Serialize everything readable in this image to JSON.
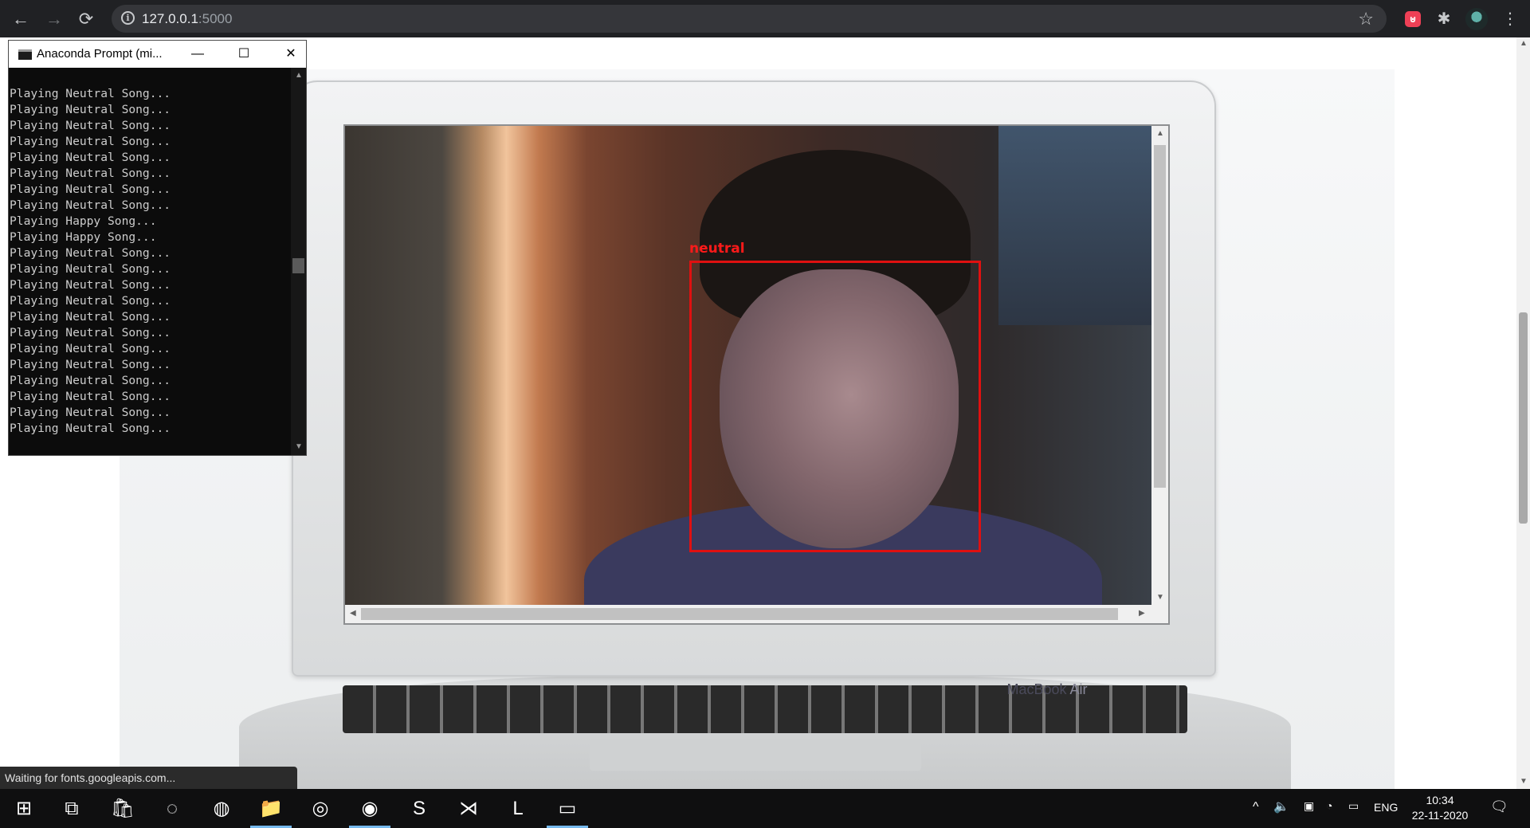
{
  "browser": {
    "url_host": "127.0.0.1",
    "url_port": ":5000",
    "back_icon": "←",
    "forward_icon": "→",
    "reload_icon": "⟳",
    "info_icon": "i",
    "star_icon": "☆",
    "pocket_icon": "⊍",
    "extensions_icon": "✱",
    "menu_icon": "⋮",
    "status_text": "Waiting for fonts.googleapis.com..."
  },
  "page": {
    "emotion_label": "neutral",
    "brand_macbook": "MacBook",
    "brand_air": " Air",
    "accent_box_color": "#e01010"
  },
  "terminal": {
    "title": "Anaconda Prompt (mi...",
    "minimize": "—",
    "maximize": "☐",
    "close": "✕",
    "lines": [
      "Playing Neutral Song...",
      "Playing Neutral Song...",
      "Playing Neutral Song...",
      "Playing Neutral Song...",
      "Playing Neutral Song...",
      "Playing Neutral Song...",
      "Playing Neutral Song...",
      "Playing Neutral Song...",
      "Playing Happy Song...",
      "Playing Happy Song...",
      "Playing Neutral Song...",
      "Playing Neutral Song...",
      "Playing Neutral Song...",
      "Playing Neutral Song...",
      "Playing Neutral Song...",
      "Playing Neutral Song...",
      "Playing Neutral Song...",
      "Playing Neutral Song...",
      "Playing Neutral Song...",
      "Playing Neutral Song...",
      "Playing Neutral Song...",
      "Playing Neutral Song..."
    ]
  },
  "taskbar": {
    "apps": [
      {
        "name": "start-button",
        "glyph": "⊞"
      },
      {
        "name": "task-view-button",
        "glyph": "⧉"
      },
      {
        "name": "store-icon",
        "glyph": "🛍"
      },
      {
        "name": "loader-app-icon",
        "glyph": "◌"
      },
      {
        "name": "firefox-icon",
        "glyph": "◍"
      },
      {
        "name": "file-explorer-icon",
        "glyph": "📁"
      },
      {
        "name": "media-app-icon",
        "glyph": "◎"
      },
      {
        "name": "chrome-icon",
        "glyph": "◉"
      },
      {
        "name": "sublime-text-icon",
        "glyph": "S"
      },
      {
        "name": "vscode-icon",
        "glyph": "⋊"
      },
      {
        "name": "l-app-icon",
        "glyph": "L"
      },
      {
        "name": "terminal-icon",
        "glyph": "▭"
      }
    ],
    "tray_chevron": "^",
    "volume_icon": "🔈",
    "language": "ENG",
    "time": "10:34",
    "date": "22-11-2020",
    "notification_icon": "🗨"
  }
}
